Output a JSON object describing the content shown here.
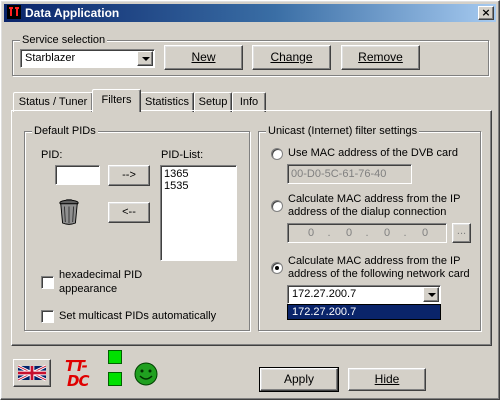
{
  "window": {
    "title": "Data Application",
    "close_glyph": "×",
    "app_icon": "tt-dc-icon"
  },
  "service": {
    "group_title": "Service selection",
    "selected": "Starblazer",
    "new_label": "New",
    "change_label": "Change",
    "remove_label": "Remove"
  },
  "tabs": [
    {
      "label": "Status / Tuner",
      "active": false
    },
    {
      "label": "Filters",
      "active": true
    },
    {
      "label": "Statistics",
      "active": false
    },
    {
      "label": "Setup",
      "active": false
    },
    {
      "label": "Info",
      "active": false
    }
  ],
  "default_pids": {
    "group_title": "Default PIDs",
    "pid_label": "PID:",
    "pid_value": "",
    "add_arrow": "-->",
    "remove_arrow": "<--",
    "trash_icon": "trash-icon",
    "pid_list_label": "PID-List:",
    "pid_list": [
      "1365",
      "1535"
    ],
    "hex_checkbox_line1": "hexadecimal PID",
    "hex_checkbox_line2": "appearance",
    "hex_checked": false,
    "multicast_label": "Set multicast PIDs automatically",
    "multicast_checked": false
  },
  "unicast": {
    "group_title": "Unicast (Internet) filter settings",
    "option1_label": "Use MAC address of the DVB card",
    "mac_address": "00-D0-5C-61-76-40",
    "option2_line1": "Calculate MAC address from the IP",
    "option2_line2": "address of the dialup connection",
    "ip_segments": [
      "0",
      "0",
      "0",
      "0"
    ],
    "ip_dot": ".",
    "browse_label": "...",
    "option3_line1": "Calculate MAC address from the IP",
    "option3_line2": "address of the following network card",
    "selected_option": 3,
    "network_card_value": "172.27.200.7",
    "dropdown_highlight": "172.27.200.7"
  },
  "footer": {
    "flag_icon": "uk-flag-icon",
    "logo_text_top": "TT-",
    "logo_text_bottom": "DC",
    "status_led_color": "#00e000",
    "smiley_icon": "smiley-icon",
    "apply_label": "Apply",
    "hide_label": "Hide"
  }
}
